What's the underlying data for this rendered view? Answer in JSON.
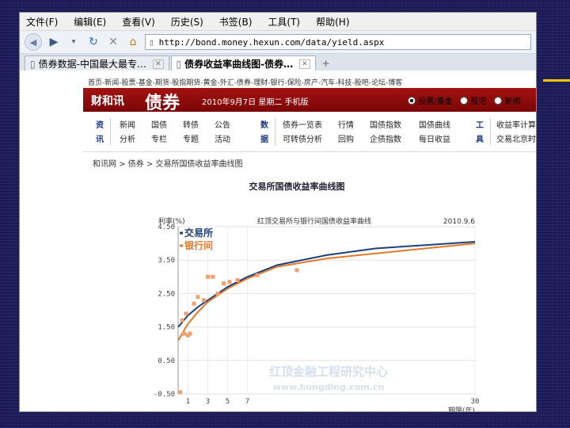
{
  "menubar": {
    "items": [
      "文件(F)",
      "编辑(E)",
      "查看(V)",
      "历史(S)",
      "书签(B)",
      "工具(T)",
      "帮助(H)"
    ]
  },
  "navbar": {
    "address": "http://bond.money.hexun.com/data/yield.aspx"
  },
  "tabs": [
    {
      "label": "债券数据-中国最大最专…"
    },
    {
      "label": "债券收益率曲线图-债券…"
    }
  ],
  "site": {
    "topnav": "首页-新闻-股票-基金-期货-股指期货-黄金-外汇-债券-理财-银行-保险-房产-汽车-科技-股吧-论坛-博客",
    "logo_text": "财和讯",
    "logo_section": "债券",
    "date_text": "2010年9月7日 星期二  手机版",
    "radios": [
      {
        "label": "股票/基金",
        "checked": true
      },
      {
        "label": "股吧",
        "checked": false
      },
      {
        "label": "新闻",
        "checked": false
      }
    ],
    "subnav": {
      "group1_label_top": "资",
      "group1_label_bottom": "讯",
      "group1_row1": [
        "新闻",
        "国债",
        "转债",
        "公告"
      ],
      "group1_row2": [
        "分析",
        "专栏",
        "专题",
        "活动"
      ],
      "group2_label_top": "数",
      "group2_label_bottom": "据",
      "group2_row1": [
        "债券一览表",
        "行情",
        "国债指数",
        "国债曲线"
      ],
      "group2_row2": [
        "可转债分析",
        "回购",
        "企债指数",
        "每日收益"
      ],
      "group3_label_top": "工",
      "group3_label_bottom": "具",
      "group3_row1": [
        "收益率计算"
      ],
      "group3_row2": [
        "交易北京时"
      ]
    },
    "breadcrumb": "和讯网 > 债券 > 交易所国债收益率曲线图"
  },
  "chart_data": {
    "type": "line",
    "title": "交易所国债收益率曲线图",
    "ylabel": "利率(%)",
    "xlabel": "期限(年)",
    "subtitle_right": "红顶交易所与银行间国债收益率曲线",
    "date_label": "2010.9.6",
    "xlim": [
      0,
      30
    ],
    "ylim": [
      -0.5,
      4.5
    ],
    "x_ticks": [
      1,
      3,
      5,
      7,
      30
    ],
    "y_ticks": [
      -0.5,
      0.5,
      1.5,
      2.5,
      3.5,
      4.5
    ],
    "y_tick_labels": [
      "-0.50",
      "0.50",
      "1.50",
      "2.50",
      "3.50",
      "4.50"
    ],
    "legend": [
      "交易所",
      "银行间"
    ],
    "watermark_line1": "红顶金融工程研究中心",
    "watermark_line2": "www.hongding.com.cn",
    "series": [
      {
        "name": "交易所",
        "color": "#1f3f7a",
        "x": [
          0,
          1,
          2,
          3,
          5,
          7,
          10,
          15,
          20,
          25,
          30
        ],
        "y": [
          1.5,
          1.85,
          2.1,
          2.3,
          2.7,
          3.0,
          3.35,
          3.65,
          3.85,
          3.95,
          4.05
        ]
      },
      {
        "name": "银行间",
        "color": "#e07a2a",
        "x": [
          0,
          1,
          2,
          3,
          5,
          7,
          10,
          15,
          20,
          25,
          30
        ],
        "y": [
          1.1,
          1.6,
          1.95,
          2.25,
          2.65,
          2.95,
          3.3,
          3.55,
          3.7,
          3.85,
          4.0
        ]
      }
    ],
    "scatter": {
      "color": "#f0a070",
      "x": [
        0.2,
        0.4,
        0.6,
        0.8,
        1.0,
        1.2,
        1.6,
        2.0,
        2.6,
        3.0,
        3.5,
        4.0,
        4.6,
        5.2,
        6.0,
        8.0,
        12.0
      ],
      "y": [
        -0.45,
        1.7,
        1.3,
        1.9,
        1.25,
        1.3,
        2.2,
        2.4,
        2.3,
        3.0,
        3.0,
        2.5,
        2.8,
        2.85,
        2.9,
        3.05,
        3.2
      ]
    }
  }
}
